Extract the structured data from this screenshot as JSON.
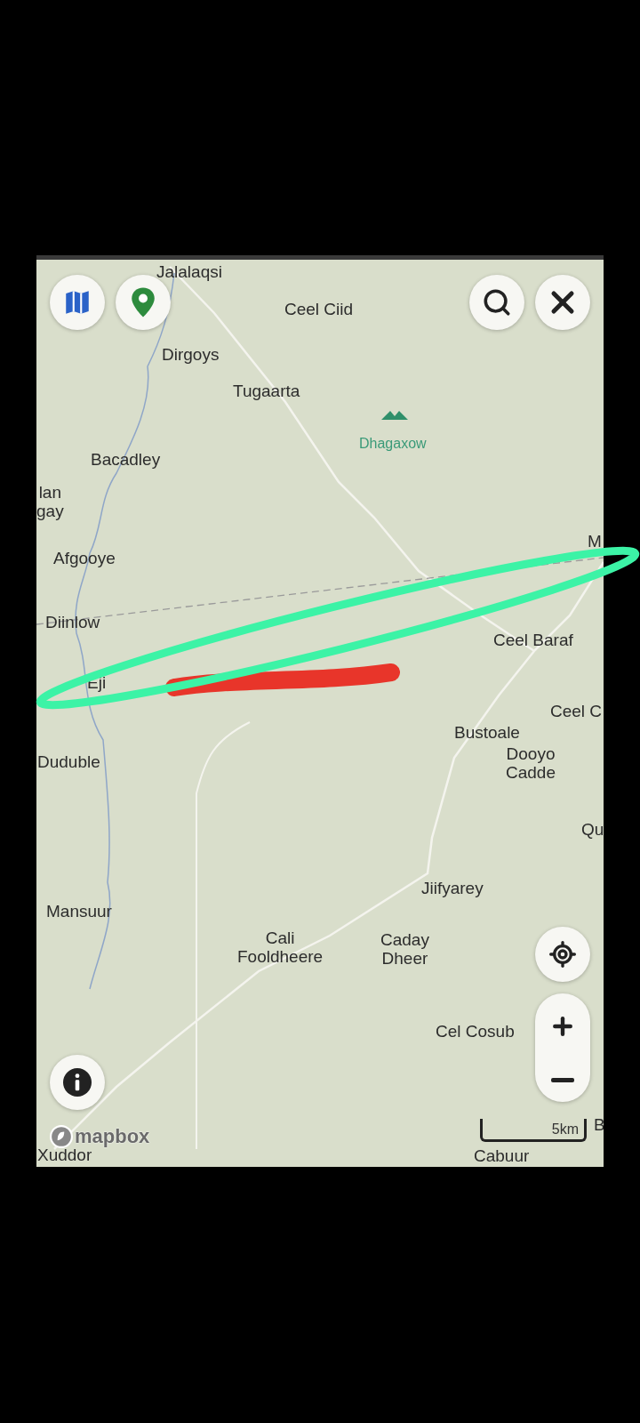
{
  "map": {
    "labels": [
      {
        "kind": "town",
        "lines": [
          "Jalalaqsi"
        ]
      },
      {
        "kind": "town",
        "lines": [
          "Ceel Ciid"
        ]
      },
      {
        "kind": "town",
        "lines": [
          "Dirgoys"
        ]
      },
      {
        "kind": "town",
        "lines": [
          "Tugaarta"
        ]
      },
      {
        "kind": "peak",
        "lines": [
          "Dhagaxow"
        ]
      },
      {
        "kind": "town",
        "lines": [
          "Bacadley"
        ]
      },
      {
        "kind": "town",
        "lines": [
          "lan",
          "gay"
        ]
      },
      {
        "kind": "town",
        "lines": [
          "Afgooye"
        ]
      },
      {
        "kind": "town",
        "lines": [
          "Diinlow"
        ]
      },
      {
        "kind": "town",
        "lines": [
          "Eji"
        ]
      },
      {
        "kind": "town",
        "lines": [
          "Ceel Baraf"
        ]
      },
      {
        "kind": "town",
        "lines": [
          "Ceel C"
        ]
      },
      {
        "kind": "town",
        "lines": [
          "Bustoale"
        ]
      },
      {
        "kind": "town",
        "lines": [
          "Dooyo",
          "Cadde"
        ]
      },
      {
        "kind": "town",
        "lines": [
          "Qu"
        ]
      },
      {
        "kind": "town",
        "lines": [
          "Duduble"
        ]
      },
      {
        "kind": "town",
        "lines": [
          "Jiifyarey"
        ]
      },
      {
        "kind": "town",
        "lines": [
          "Mansuur"
        ]
      },
      {
        "kind": "town",
        "lines": [
          "Cali",
          "Fooldheere"
        ]
      },
      {
        "kind": "town",
        "lines": [
          "Caday",
          "Dheer"
        ]
      },
      {
        "kind": "town",
        "lines": [
          "Cel Cosub"
        ]
      },
      {
        "kind": "town",
        "lines": [
          "M"
        ]
      },
      {
        "kind": "town",
        "lines": [
          "B"
        ]
      },
      {
        "kind": "town",
        "lines": [
          "Xuddor"
        ]
      },
      {
        "kind": "town",
        "lines": [
          "Cabuur"
        ]
      }
    ],
    "attribution": "mapbox",
    "scale": "5km"
  }
}
